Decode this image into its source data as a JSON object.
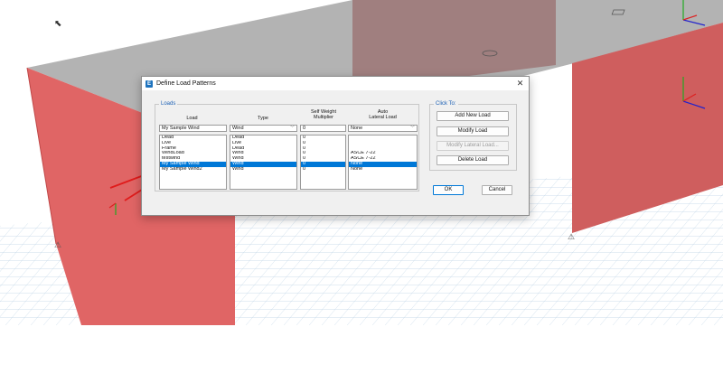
{
  "dialog": {
    "title": "Define Load Patterns",
    "app_icon_letter": "E",
    "close_glyph": "✕"
  },
  "loads": {
    "legend": "Loads",
    "headers": {
      "load": "Load",
      "type": "Type",
      "self_weight": "Self Weight\nMultiplier",
      "auto_lateral": "Auto\nLateral Load"
    },
    "input": {
      "load": "My Sample Wind",
      "type": "Wind",
      "self_weight": "0",
      "auto_lateral": "None"
    },
    "rows": [
      {
        "load": "Dead",
        "type": "Dead",
        "multiplier": "0",
        "auto": ""
      },
      {
        "load": "Live",
        "type": "Live",
        "multiplier": "0",
        "auto": ""
      },
      {
        "load": "Frame",
        "type": "Dead",
        "multiplier": "0",
        "auto": ""
      },
      {
        "load": "WindLoad",
        "type": "Wind",
        "multiplier": "0",
        "auto": "ASCE 7-22"
      },
      {
        "load": "testwind",
        "type": "Wind",
        "multiplier": "0",
        "auto": "ASCE 7-22"
      },
      {
        "load": "My Sample Wind",
        "type": "Wind",
        "multiplier": "0",
        "auto": "None"
      },
      {
        "load": "My Sample Wind2",
        "type": "Wind",
        "multiplier": "0",
        "auto": "None"
      }
    ],
    "selected_index": 5
  },
  "click_to": {
    "legend": "Click To:",
    "add": "Add New Load",
    "modify": "Modify Load",
    "modify_lateral": "Modify Lateral Load...",
    "delete": "Delete Load"
  },
  "footer": {
    "ok": "OK",
    "cancel": "Cancel"
  },
  "colors": {
    "wall": "#e06565",
    "wall_dark": "#c85454",
    "roof": "#b5b5b5",
    "grid": "#a7c4dd",
    "selection": "#0078d7",
    "annotation_arrow": "#e01b1b"
  }
}
